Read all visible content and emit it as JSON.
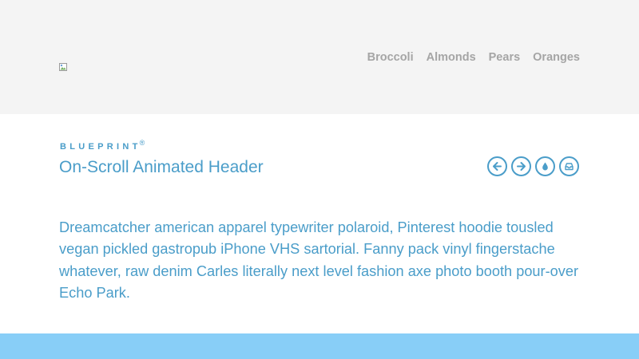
{
  "header": {
    "nav": [
      {
        "label": "Broccoli"
      },
      {
        "label": "Almonds"
      },
      {
        "label": "Pears"
      },
      {
        "label": "Oranges"
      }
    ]
  },
  "title_area": {
    "brand": "BLUEPRINT",
    "brand_mark": "®",
    "title": "On-Scroll Animated Header"
  },
  "icons": [
    {
      "name": "arrow-left-icon"
    },
    {
      "name": "arrow-right-icon"
    },
    {
      "name": "drop-icon"
    },
    {
      "name": "archive-icon"
    }
  ],
  "content": {
    "paragraph": "Dreamcatcher american apparel typewriter polaroid, Pinterest hoodie tousled vegan pickled gastropub iPhone VHS sartorial. Fanny pack vinyl fingerstache whatever, raw denim Carles literally next level fashion axe photo booth pour-over Echo Park."
  },
  "colors": {
    "accent": "#4a9dc9",
    "header_bg": "#f4f4f4",
    "nav_text": "#a5a5a5",
    "footer_band": "#88cef7"
  }
}
